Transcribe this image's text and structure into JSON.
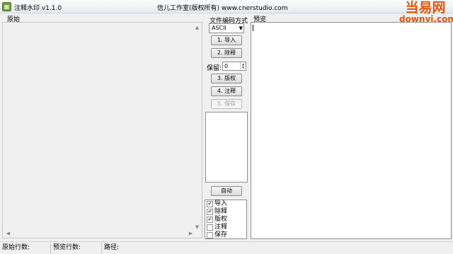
{
  "titlebar": {
    "app_icon": "grid-icon",
    "title": "注释水印 v1.1.0",
    "studio_text": "信儿工作室(版权所有) www.cnerstudio.com"
  },
  "watermark": {
    "top": "当易网",
    "bottom": "downyi.com"
  },
  "left_panel": {
    "label": "原始"
  },
  "controls": {
    "encoding_label": "文件编码方式",
    "encoding_value": "ASCII",
    "btn_import": "1. 导入",
    "btn_remove_comments": "2. 除释",
    "keep_label": "保留:",
    "keep_value": "0",
    "btn_copyright": "3. 版权",
    "btn_comment": "4. 注释",
    "btn_save": "5. 保存",
    "btn_auto": "自动"
  },
  "checklist": [
    {
      "label": "导入",
      "checked": true
    },
    {
      "label": "除释",
      "checked": true
    },
    {
      "label": "版权",
      "checked": true
    },
    {
      "label": "注释",
      "checked": false
    },
    {
      "label": "保存",
      "checked": false
    }
  ],
  "preview_panel": {
    "label": "预览"
  },
  "statusbar": {
    "original_lines": "原始行数:",
    "preview_lines": "预览行数:",
    "path": "路径:"
  }
}
